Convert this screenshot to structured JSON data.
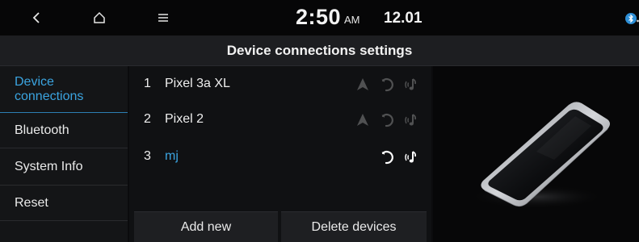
{
  "status_bar": {
    "back_icon": "chevron-left-icon",
    "home_icon": "home-icon",
    "menu_icon": "hamburger-menu-icon",
    "time": "2:50",
    "ampm": "AM",
    "date": "12.01",
    "bluetooth_status_icon": "bluetooth-connected-icon"
  },
  "title": "Device connections settings",
  "sidebar": {
    "items": [
      {
        "label": "Device connections",
        "active": true
      },
      {
        "label": "Bluetooth",
        "active": false
      },
      {
        "label": "System Info",
        "active": false
      },
      {
        "label": "Reset",
        "active": false
      }
    ]
  },
  "devices": [
    {
      "number": "1",
      "name": "Pixel 3a XL",
      "connected": false,
      "icons": [
        "android-auto-icon",
        "phone-handset-icon",
        "bluetooth-audio-icon"
      ]
    },
    {
      "number": "2",
      "name": "Pixel 2",
      "connected": false,
      "icons": [
        "android-auto-icon",
        "phone-handset-icon",
        "bluetooth-audio-icon"
      ]
    },
    {
      "number": "3",
      "name": "mj",
      "connected": true,
      "icons": [
        "phone-handset-icon",
        "bluetooth-audio-icon"
      ]
    }
  ],
  "buttons": {
    "add_new": "Add new",
    "delete_devices": "Delete devices"
  },
  "colors": {
    "accent": "#3ba4e0",
    "background": "#0b0b0d",
    "panel": "#1d1e21"
  }
}
